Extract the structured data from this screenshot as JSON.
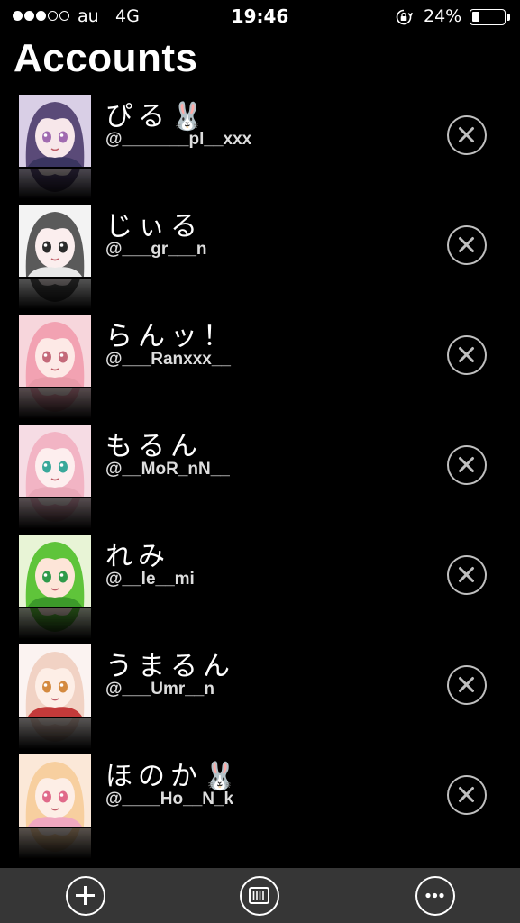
{
  "status_bar": {
    "signal_strength": 3,
    "signal_max": 5,
    "carrier": "au",
    "network": "4G",
    "time": "19:46",
    "battery_percent": "24%",
    "battery_level": 0.24
  },
  "header": {
    "title": "Accounts"
  },
  "accounts": [
    {
      "name": "ぴる🐰",
      "handle": "@_______pl__xxx",
      "avatar": {
        "hair": "#5a4a78",
        "skin": "#f7e7ea",
        "eyes": "#a06ab0",
        "bg": "#d9cfe6",
        "accent": "#3a3560"
      }
    },
    {
      "name": "じぃる",
      "handle": "@___gr___n",
      "avatar": {
        "hair": "#5a5a5a",
        "skin": "#fbeeee",
        "eyes": "#2b2b2b",
        "bg": "#f3f3f3",
        "accent": "#e8e8e8"
      }
    },
    {
      "name": "らんッ！",
      "handle": "@___Ranxxx__",
      "avatar": {
        "hair": "#f2a2b2",
        "skin": "#fde9e6",
        "eyes": "#c46a7a",
        "bg": "#f7d6dc",
        "accent": "#e89aa8"
      }
    },
    {
      "name": "もるん",
      "handle": "@__MoR_nN__",
      "avatar": {
        "hair": "#f2b4c4",
        "skin": "#fdeeee",
        "eyes": "#3aa89a",
        "bg": "#f6dce4",
        "accent": "#e9a8b8"
      }
    },
    {
      "name": "れみ",
      "handle": "@__le__mi",
      "avatar": {
        "hair": "#5fc43a",
        "skin": "#fde5d8",
        "eyes": "#2f9a4a",
        "bg": "#e8f4d6",
        "accent": "#3c9a2a"
      }
    },
    {
      "name": "うまるん",
      "handle": "@___Umr__n",
      "avatar": {
        "hair": "#f1d2c4",
        "skin": "#fdeee6",
        "eyes": "#d48a40",
        "bg": "#fbf3f1",
        "accent": "#c33a3a"
      }
    },
    {
      "name": "ほのか🐰",
      "handle": "@____Ho__N_k",
      "avatar": {
        "hair": "#f7cf9f",
        "skin": "#fdeee6",
        "eyes": "#e06a8a",
        "bg": "#fbe8d8",
        "accent": "#f0a8c0"
      }
    }
  ],
  "toolbar": {
    "add_icon": "plus-circle-icon",
    "columns_icon": "columns-icon",
    "more_icon": "ellipsis-icon"
  }
}
